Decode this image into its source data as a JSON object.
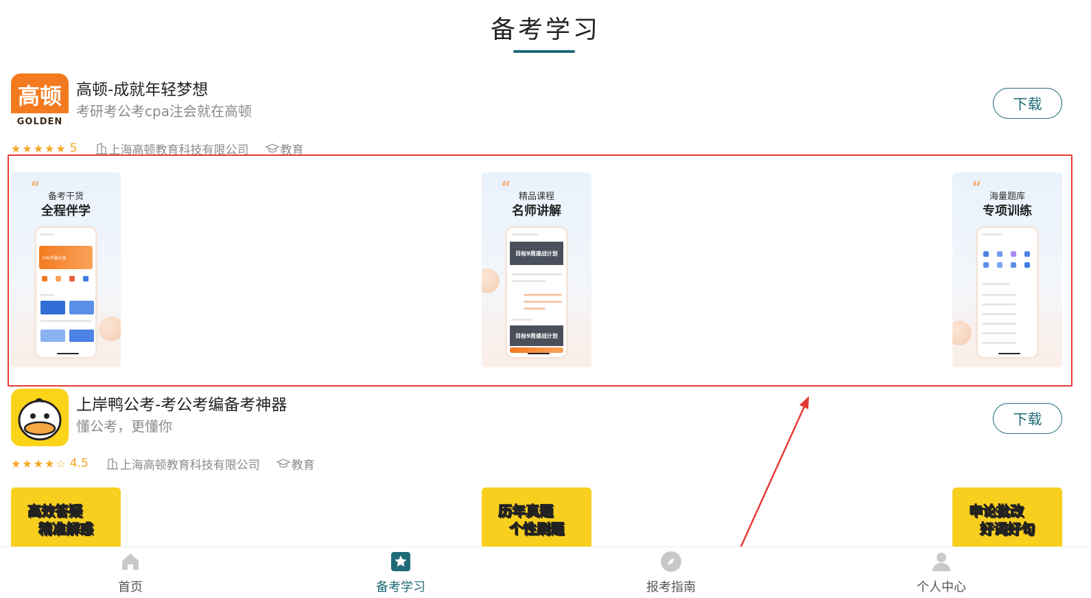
{
  "page": {
    "title": "备考学习"
  },
  "apps": [
    {
      "icon_text": "高顿",
      "icon_subtext": "GOLDEN",
      "name": "高顿-成就年轻梦想",
      "slogan": "考研考公考cpa注会就在高顿",
      "stars": "★★★★★",
      "rating": "5",
      "developer": "上海高顿教育科技有限公司",
      "category": "教育",
      "download_label": "下载",
      "screenshots": [
        {
          "subtitle": "备考干货",
          "heading": "全程伴学",
          "banner": "CPA学霸分享"
        },
        {
          "subtitle": "精品课程",
          "heading": "名师讲解",
          "banner": "目标9周速战计划",
          "banner2": "目标9周速战计划"
        },
        {
          "subtitle": "海量题库",
          "heading": "专项训练"
        }
      ]
    },
    {
      "name": "上岸鸭公考-考公考编备考神器",
      "slogan": "懂公考，更懂你",
      "stars": "★★★★☆",
      "rating": "4.5",
      "developer": "上海高顿教育科技有限公司",
      "category": "教育",
      "download_label": "下载",
      "screenshots": [
        {
          "line1": "高效答疑",
          "line2": "精准解惑"
        },
        {
          "line1": "历年真题",
          "line2": "个性刷题"
        },
        {
          "line1": "申论批改",
          "line2": "好词好句"
        }
      ]
    }
  ],
  "tabs": [
    {
      "label": "首页",
      "icon": "home-icon"
    },
    {
      "label": "备考学习",
      "icon": "star-icon",
      "active": true
    },
    {
      "label": "报考指南",
      "icon": "compass-icon"
    },
    {
      "label": "个人中心",
      "icon": "user-icon"
    }
  ],
  "colors": {
    "accent": "#1f6b78",
    "annotation": "#e53935",
    "star": "#f5a623",
    "golden_orange": "#f47a20",
    "duck_yellow": "#fbd318"
  }
}
